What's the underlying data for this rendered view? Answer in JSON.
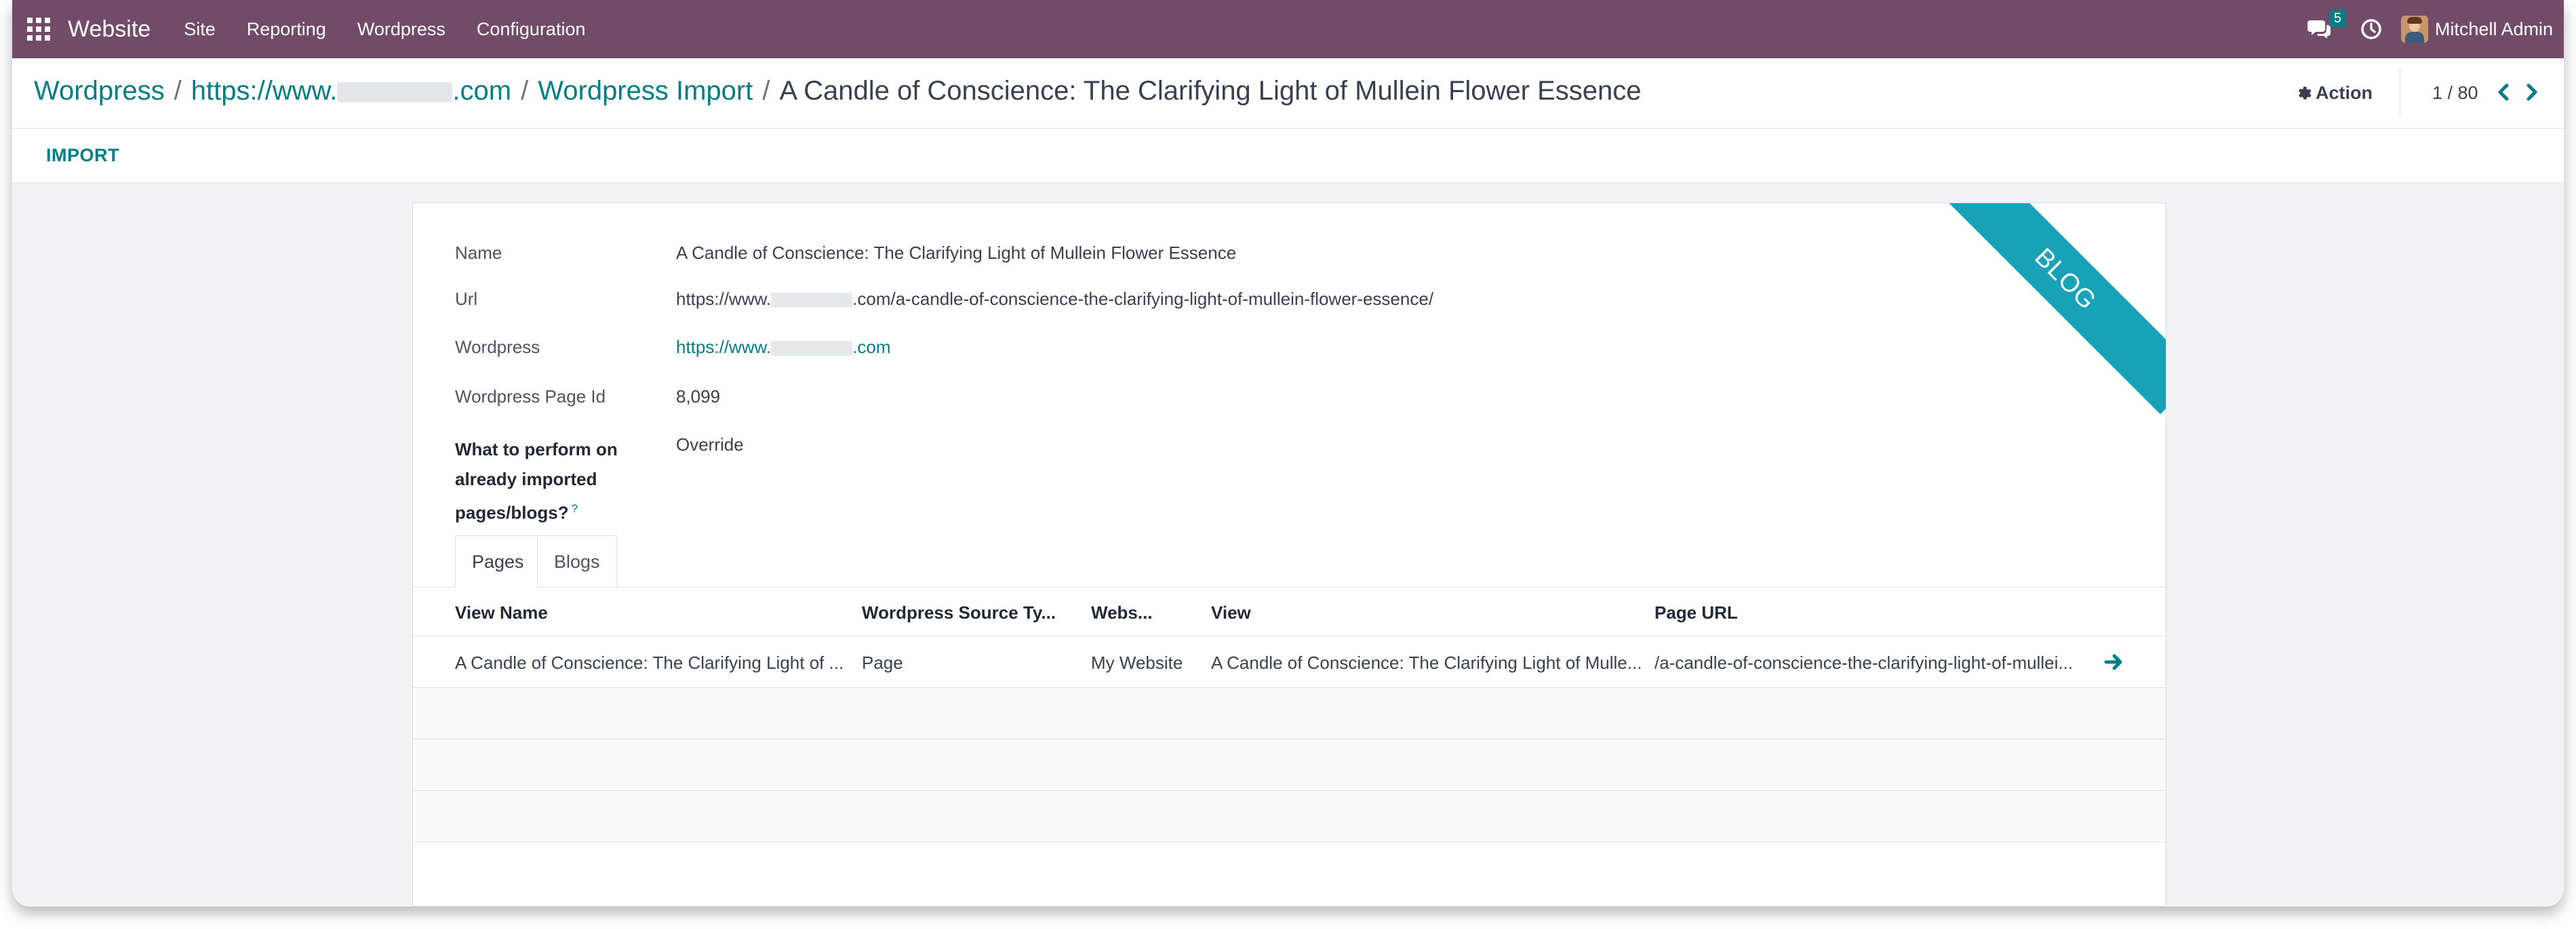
{
  "navbar": {
    "app_name": "Website",
    "menu": [
      "Site",
      "Reporting",
      "Wordpress",
      "Configuration"
    ],
    "message_count": "5",
    "user_name": "Mitchell Admin"
  },
  "breadcrumb": {
    "root": "Wordpress",
    "site_prefix": "https://www.",
    "site_suffix": ".com",
    "section": "Wordpress Import",
    "current": "A Candle of Conscience: The Clarifying Light of Mullein Flower Essence",
    "separator": "/"
  },
  "control_panel": {
    "action_label": "Action",
    "pager": "1 / 80"
  },
  "statusbar": {
    "import_label": "IMPORT"
  },
  "form": {
    "ribbon": "BLOG",
    "fields": {
      "name_label": "Name",
      "name_value": "A Candle of Conscience: The Clarifying Light of Mullein Flower Essence",
      "url_label": "Url",
      "url_prefix": "https://www.",
      "url_suffix": ".com/a-candle-of-conscience-the-clarifying-light-of-mullein-flower-essence/",
      "wordpress_label": "Wordpress",
      "wordpress_prefix": "https://www.",
      "wordpress_suffix": ".com",
      "page_id_label": "Wordpress Page Id",
      "page_id_value": "8,099",
      "perform_label": "What to perform on already imported pages/blogs?",
      "perform_help": "?",
      "perform_value": "Override"
    },
    "tabs": [
      "Pages",
      "Blogs"
    ],
    "table": {
      "headers": [
        "View Name",
        "Wordpress Source Ty...",
        "Webs...",
        "View",
        "Page URL"
      ],
      "rows": [
        [
          "A Candle of Conscience: The Clarifying Light of ...",
          "Page",
          "My Website",
          "A Candle of Conscience: The Clarifying Light of Mulle...",
          "/a-candle-of-conscience-the-clarifying-light-of-mullei..."
        ]
      ]
    }
  },
  "colors": {
    "navbar": "#714b67",
    "link": "#017e84",
    "ribbon": "#17a2b8"
  }
}
